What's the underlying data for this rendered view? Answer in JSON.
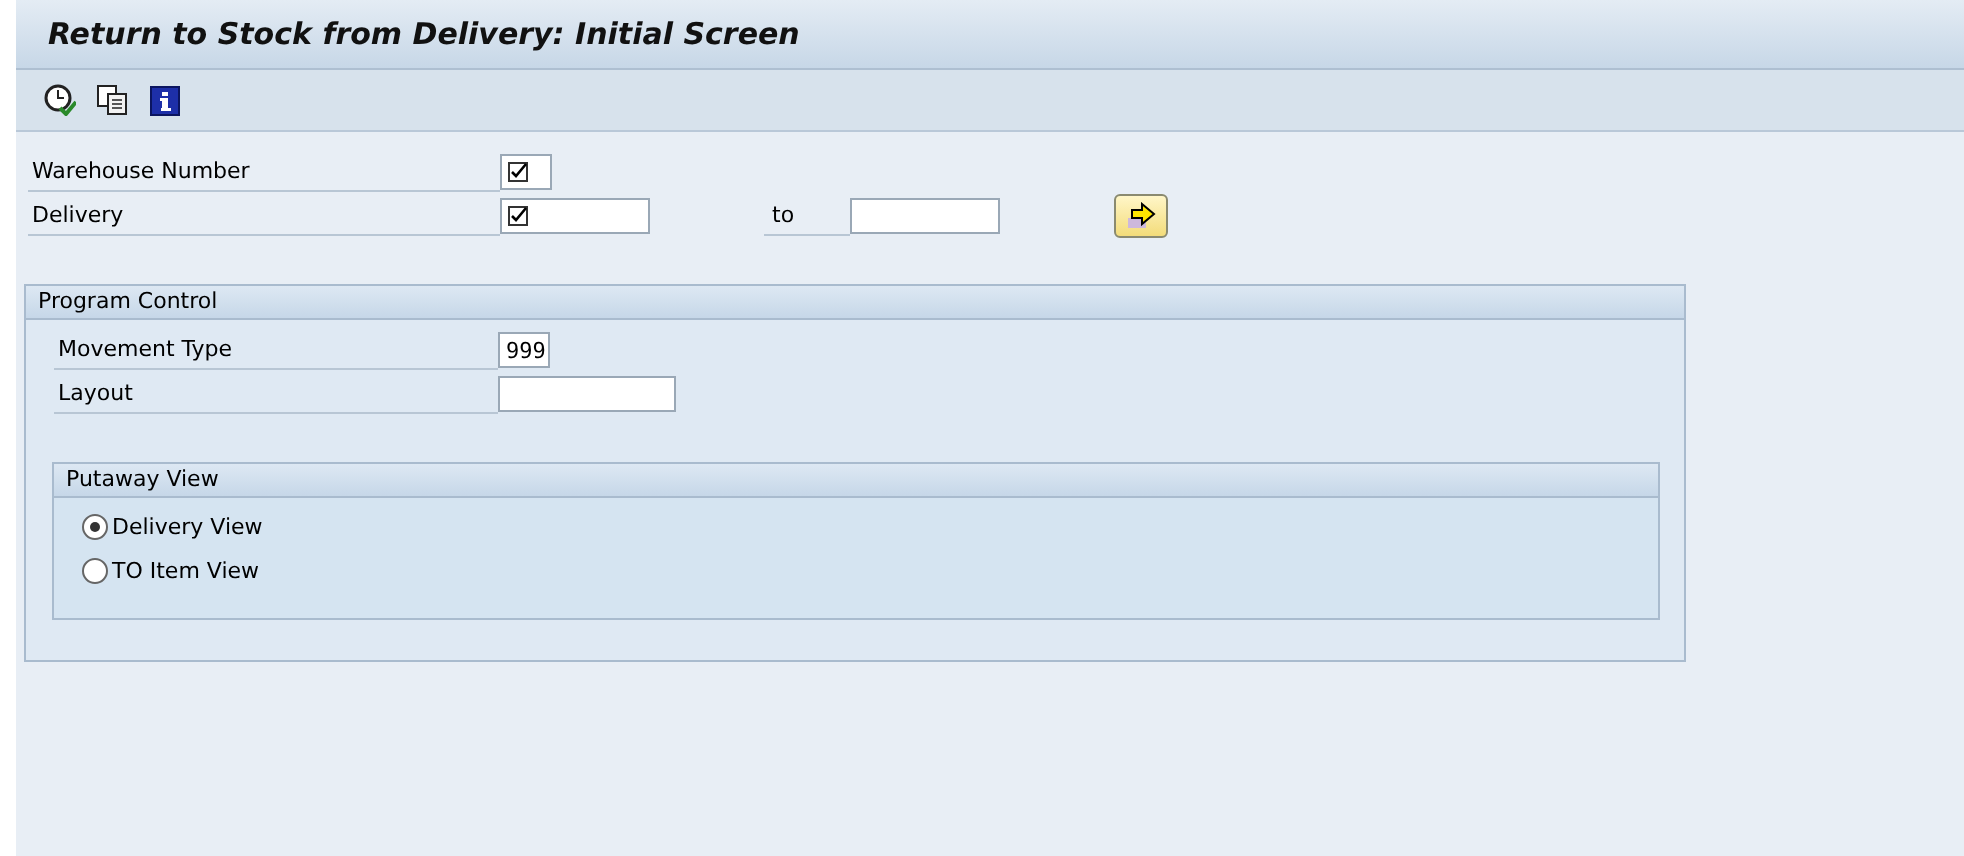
{
  "window": {
    "title": "Return to Stock from Delivery: Initial Screen"
  },
  "toolbar": [
    {
      "kind": "execute"
    },
    {
      "kind": "variants"
    },
    {
      "kind": "info"
    }
  ],
  "selection": [
    {
      "label": "Warehouse Number",
      "required": true
    },
    {
      "label": "Delivery",
      "required": true,
      "to_label": "to"
    }
  ],
  "program_control": {
    "title": "Program Control",
    "fields": [
      {
        "label": "Movement Type",
        "value": "999"
      },
      {
        "label": "Layout"
      }
    ],
    "putaway_view": {
      "title": "Putaway View",
      "options": [
        {
          "label": "Delivery View",
          "selected": true
        },
        {
          "label": "TO Item View",
          "selected": false
        }
      ]
    }
  }
}
